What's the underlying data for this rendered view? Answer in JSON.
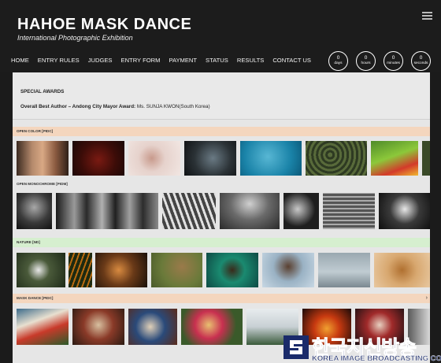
{
  "header": {
    "title": "HAHOE MASK DANCE",
    "subtitle": "International Photographic Exhibition"
  },
  "nav": [
    "HOME",
    "ENTRY RULES",
    "JUDGES",
    "ENTRY FORM",
    "PAYMENT",
    "STATUS",
    "RESULTS",
    "CONTACT US"
  ],
  "countdown": [
    {
      "value": "0",
      "unit": "days"
    },
    {
      "value": "0",
      "unit": "hours"
    },
    {
      "value": "0",
      "unit": "minutes"
    },
    {
      "value": "0",
      "unit": "seconds"
    }
  ],
  "special_awards": {
    "heading": "SPECIAL AWARDS",
    "award_label": "Overall Best Author – Andong City Mayor Award:",
    "award_winner": " Ms. SUNJA KWON(South Korea)"
  },
  "sections": [
    {
      "label": "OPEN COLOR [PIDC]",
      "color": "#f4d6be"
    },
    {
      "label": "OPEN MONOCHROME [PIDM]",
      "color": "#e6e6e6"
    },
    {
      "label": "NATURE [ND]",
      "color": "#d6efcf"
    },
    {
      "label": "MASK DANCE [PIDC]",
      "color": "#f4d6be"
    }
  ],
  "watermark": {
    "korean": "한국지신방송",
    "english": "KOREA IMAGE BROADCASTING CO."
  }
}
